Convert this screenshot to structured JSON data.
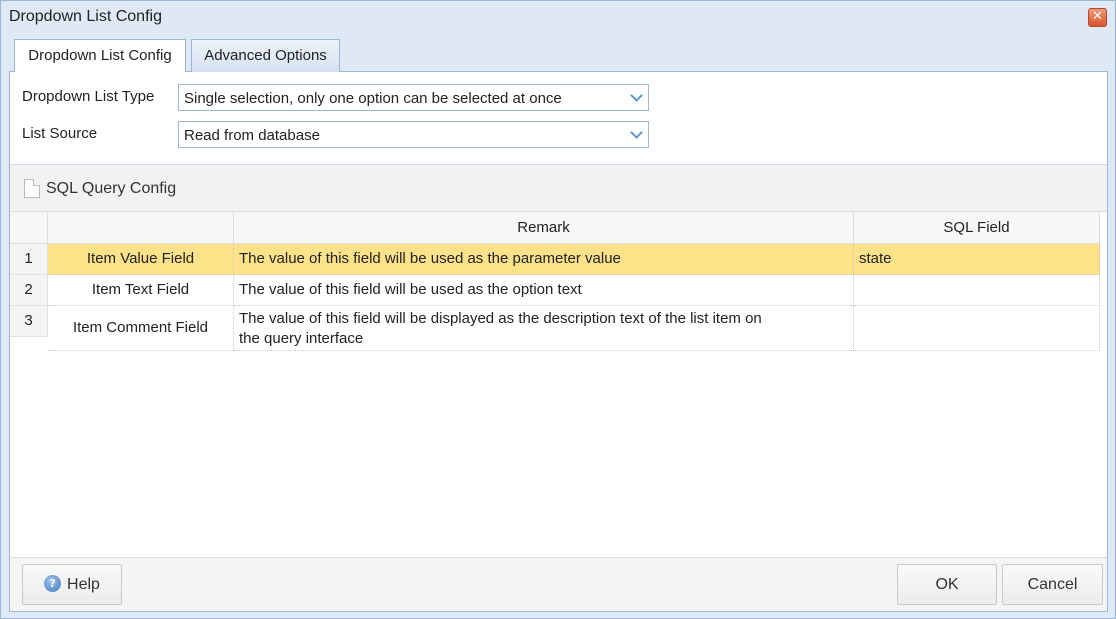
{
  "window": {
    "title": "Dropdown List Config",
    "close_glyph": "✕"
  },
  "tabs": [
    {
      "label": "Dropdown List Config",
      "active": true
    },
    {
      "label": "Advanced Options",
      "active": false
    }
  ],
  "form": {
    "type_label": "Dropdown List Type",
    "type_value": "Single selection, only one option can be selected at once",
    "source_label": "List Source",
    "source_value": "Read from database"
  },
  "sql_section": {
    "title": "SQL Query Config",
    "icon": "document-icon"
  },
  "grid": {
    "columns": [
      "",
      "",
      "Remark",
      "SQL Field"
    ],
    "rows": [
      {
        "num": "1",
        "field": "Item Value Field",
        "remark": "The value of this field will be used as the parameter value",
        "sql_field": "state",
        "selected": true
      },
      {
        "num": "2",
        "field": "Item Text Field",
        "remark": "The value of this field will be used as the option text",
        "sql_field": "",
        "selected": false
      },
      {
        "num": "3",
        "field": "Item Comment Field",
        "remark_line1": "The value of this field will be displayed as the description text of the list item on",
        "remark_line2": "the query interface",
        "sql_field": "",
        "selected": false
      }
    ]
  },
  "footer": {
    "help_label": "Help",
    "help_icon_glyph": "?",
    "ok_label": "OK",
    "cancel_label": "Cancel"
  },
  "colors": {
    "selected_row": "#fde28a",
    "frame_border": "#9cb6d6",
    "accent_arrow": "#5b9bd5"
  }
}
